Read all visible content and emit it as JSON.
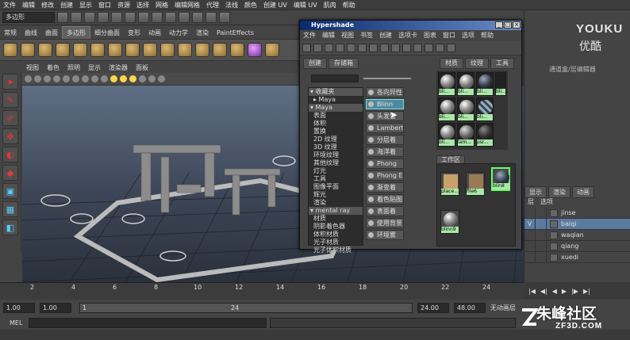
{
  "menubar": [
    "文件",
    "编辑",
    "修改",
    "创建",
    "显示",
    "窗口",
    "资源",
    "选择",
    "网格",
    "编辑网格",
    "代理",
    "法线",
    "颜色",
    "创建 UV",
    "编辑 UV",
    "肌肉",
    "帮助"
  ],
  "statusline": {
    "mode": "多边形"
  },
  "shelf": {
    "tabs": [
      "常规",
      "曲线",
      "曲面",
      "多边形",
      "细分曲面",
      "变形",
      "动画",
      "动力学",
      "渲染",
      "PaintEffects"
    ],
    "active": "多边形"
  },
  "viewport": {
    "menu": [
      "视图",
      "着色",
      "照明",
      "显示",
      "渲染器",
      "面板"
    ]
  },
  "timeline": {
    "ticks": [
      "2",
      "4",
      "6",
      "8",
      "10",
      "12",
      "14",
      "16",
      "18",
      "20",
      "22",
      "24"
    ]
  },
  "range": {
    "start": "1.00",
    "start2": "1.00",
    "cur": "1",
    "end_mark": "24",
    "end": "24.00",
    "end2": "48.00",
    "anim_layer": "无动画层"
  },
  "mel": {
    "label": "MEL"
  },
  "brand": {
    "youku": "YOUKU",
    "youku_cn": "优酷",
    "wm_cn": "朱峰社区",
    "wm_en": "ZF3D.COM"
  },
  "channelbox": {
    "label": "通道盒/层编辑器"
  },
  "layers": {
    "tabs": [
      "显示",
      "渲染",
      "动画"
    ],
    "menu": [
      "层",
      "选项"
    ],
    "items": [
      {
        "v": "",
        "name": "jinse",
        "sel": false
      },
      {
        "v": "V",
        "name": "baiqi",
        "sel": true
      },
      {
        "v": "",
        "name": "waqian",
        "sel": false
      },
      {
        "v": "",
        "name": "qiang",
        "sel": false
      },
      {
        "v": "",
        "name": "xuedi",
        "sel": false
      }
    ]
  },
  "hypershade": {
    "title": "Hypershade",
    "menu": [
      "文件",
      "编辑",
      "视图",
      "书签",
      "创建",
      "选项卡",
      "图表",
      "窗口",
      "选项",
      "帮助"
    ],
    "left_tabs": [
      "创建",
      "存储箱"
    ],
    "tree": [
      {
        "t": "▾ 收藏夹",
        "h": true
      },
      {
        "t": "▸ Maya",
        "h": false
      },
      {
        "t": "▾ Maya",
        "h": true
      },
      {
        "t": "表面",
        "h": false
      },
      {
        "t": "体积",
        "h": false
      },
      {
        "t": "置换",
        "h": false
      },
      {
        "t": "2D 纹理",
        "h": false
      },
      {
        "t": "3D 纹理",
        "h": false
      },
      {
        "t": "环境纹理",
        "h": false
      },
      {
        "t": "其他纹理",
        "h": false
      },
      {
        "t": "灯光",
        "h": false
      },
      {
        "t": "工具",
        "h": false
      },
      {
        "t": "图像平面",
        "h": false
      },
      {
        "t": "辉光",
        "h": false
      },
      {
        "t": "渲染",
        "h": false
      },
      {
        "t": "▾ mental ray",
        "h": true
      },
      {
        "t": "材质",
        "h": false
      },
      {
        "t": "阴影着色器",
        "h": false
      },
      {
        "t": "体积材质",
        "h": false
      },
      {
        "t": "光子材质",
        "h": false
      },
      {
        "t": "光子体积材质",
        "h": false
      }
    ],
    "create": [
      "各向异性",
      "Blinn",
      "头发管",
      "Lambert",
      "分层着",
      "海洋着",
      "Phong",
      "Phong E",
      "渐变着",
      "着色贴图",
      "表面着",
      "使用背景",
      "环境雾"
    ],
    "right_tabs": [
      "材质",
      "纹理",
      "工具"
    ],
    "swatches": [
      "bli...",
      "bli...",
      "bli...",
      "bli...",
      "bli...",
      "bli...",
      "bli...",
      "lam...",
      "psr...",
      "bli..."
    ],
    "work_tab": "工作区",
    "nodes": [
      "place...",
      "file6",
      "blin8",
      "blinn9"
    ]
  }
}
